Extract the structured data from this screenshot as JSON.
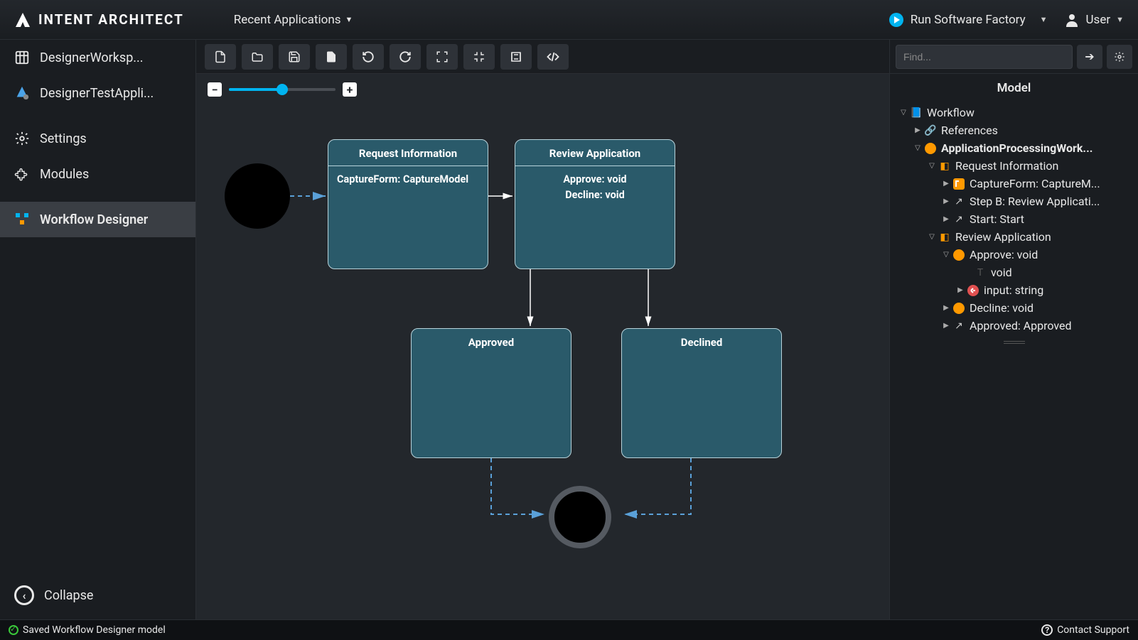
{
  "header": {
    "brand": "INTENT ARCHITECT",
    "recent_apps": "Recent Applications",
    "run_factory": "Run Software Factory",
    "user": "User"
  },
  "sidebar": {
    "items": [
      {
        "label": "DesignerWorksp...",
        "icon": "grid"
      },
      {
        "label": "DesignerTestAppli...",
        "icon": "app"
      },
      {
        "label": "Settings",
        "icon": "gear"
      },
      {
        "label": "Modules",
        "icon": "puzzle"
      },
      {
        "label": "Workflow Designer",
        "icon": "workflow",
        "active": true
      }
    ],
    "collapse": "Collapse"
  },
  "canvas": {
    "nodes": {
      "request_information": {
        "title": "Request Information",
        "body": [
          "CaptureForm: CaptureModel"
        ]
      },
      "review_application": {
        "title": "Review Application",
        "body": [
          "Approve: void",
          "Decline: void"
        ]
      },
      "approved": {
        "title": "Approved"
      },
      "declined": {
        "title": "Declined"
      }
    }
  },
  "right_panel": {
    "search_placeholder": "Find...",
    "title": "Model",
    "tree": {
      "root": "Workflow",
      "references": "References",
      "app": "ApplicationProcessingWork...",
      "req_info": "Request Information",
      "capture": "CaptureForm: CaptureM...",
      "step_b": "Step B: Review Applicati...",
      "start": "Start: Start",
      "review": "Review Application",
      "approve": "Approve: void",
      "void_type": "void",
      "input": "input: string",
      "decline": "Decline: void",
      "approved": "Approved: Approved"
    }
  },
  "status": {
    "message": "Saved Workflow Designer model",
    "support": "Contact Support"
  }
}
